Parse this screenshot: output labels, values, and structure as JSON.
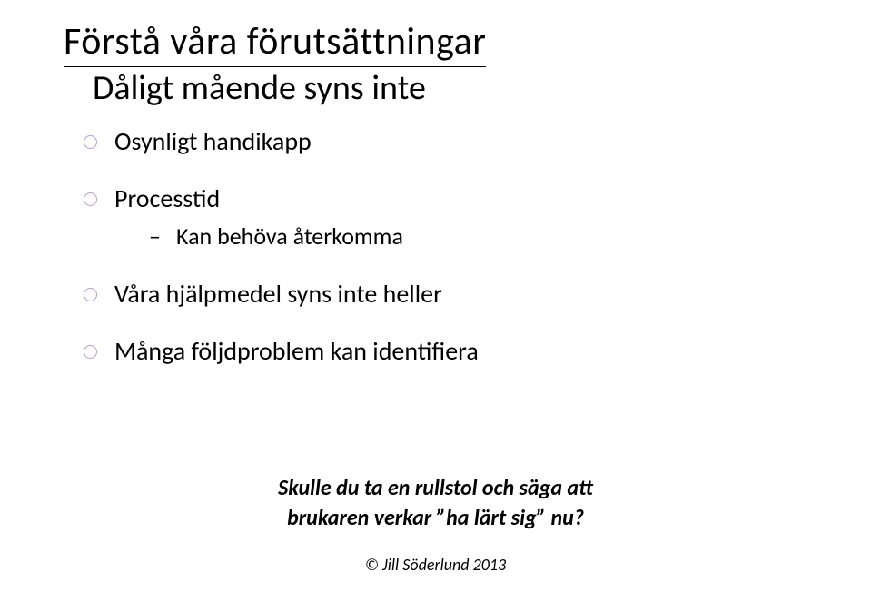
{
  "title": "Förstå våra förutsättningar",
  "subtitle": "Dåligt mående syns inte",
  "bullets": [
    {
      "text": "Osynligt handikapp",
      "sub": []
    },
    {
      "text": "Processtid",
      "sub": [
        {
          "text": "Kan behöva återkomma"
        }
      ]
    },
    {
      "text": "Våra hjälpmedel syns inte heller",
      "sub": []
    },
    {
      "text": "Många följdproblem kan identifiera",
      "sub": []
    }
  ],
  "callout": {
    "line1": "Skulle du ta en rullstol och säga att",
    "line2": "brukaren verkar ”ha lärt sig” nu?"
  },
  "footer": "© Jill Söderlund 2013"
}
